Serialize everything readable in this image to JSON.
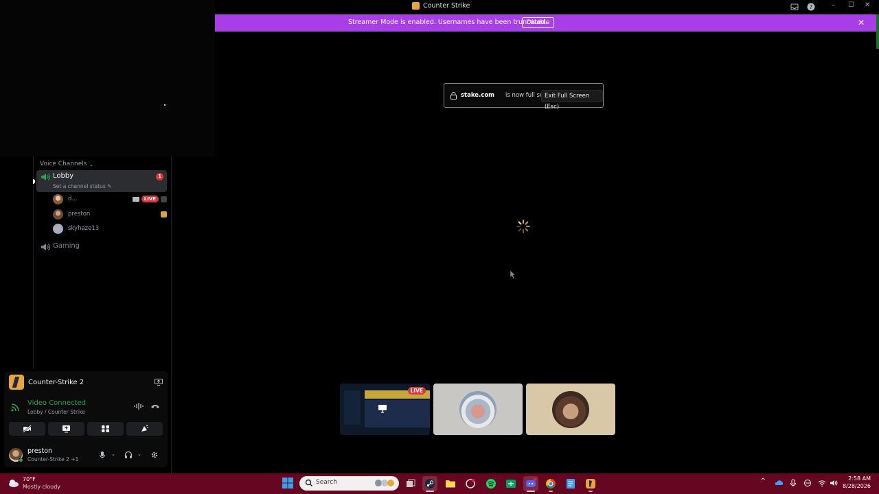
{
  "titlebar": {
    "title": "Counter Strike"
  },
  "banner": {
    "text": "Streamer Mode is enabled. Usernames have been truncated.",
    "disable_label": "Disable",
    "close_glyph": "✕"
  },
  "fullscreen_notice": {
    "domain": "stake.com",
    "text": "is now full screen",
    "exit_label": "Exit Full Screen (Esc)"
  },
  "sidebar": {
    "voice_header": "Voice Channels",
    "channels": [
      {
        "name": "Lobby",
        "status": "Set a channel status",
        "badge": "1"
      },
      {
        "name": "Gaming"
      }
    ],
    "members": [
      {
        "name": "d...",
        "live_label": "LIVE"
      },
      {
        "name": "preston"
      },
      {
        "name": "skyhaze13"
      }
    ]
  },
  "voice_panel": {
    "game_name": "Counter-Strike 2",
    "connection_title": "Video Connected",
    "connection_sub": "Lobby / Counter Strike",
    "user_name": "preston",
    "user_status": "Counter-Strike 2 +1"
  },
  "stream_tiles": {
    "live_label": "LIVE"
  },
  "taskbar": {
    "temperature": "70°F",
    "condition": "Mostly cloudy",
    "search_placeholder": "Search",
    "time": "2:58 AM",
    "date": "8/28/2026"
  },
  "colors": {
    "banner": "#a83ee6",
    "taskbar": "#660721",
    "live_red": "#da373c",
    "connected_green": "#23a55a"
  }
}
